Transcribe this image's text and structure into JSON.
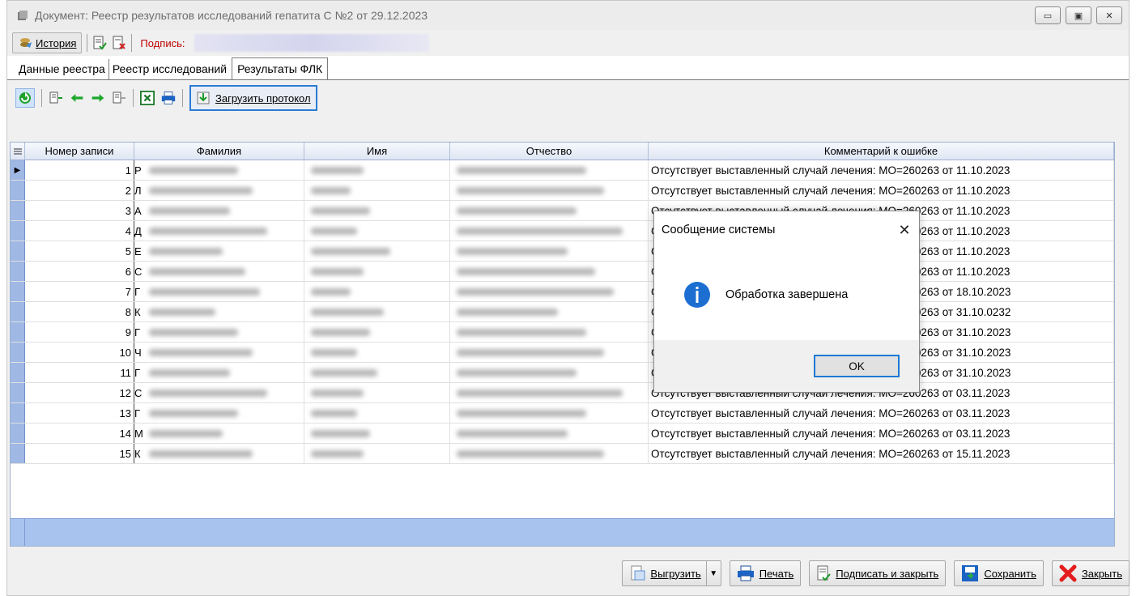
{
  "window": {
    "title": "Документ: Реестр результатов исследований гепатита С №2 от 29.12.2023",
    "btn_min": "▭",
    "btn_max": "▣",
    "btn_close": "✕"
  },
  "toolbar1": {
    "history_label": "История",
    "sign_label": "Подпись:"
  },
  "tabs": [
    {
      "label": "Данные реестра"
    },
    {
      "label": "Реестр исследований"
    },
    {
      "label": "Результаты ФЛК"
    }
  ],
  "toolbar2": {
    "load_protocol_label": "Загрузить протокол"
  },
  "grid": {
    "columns": [
      "Номер записи",
      "Фамилия",
      "Имя",
      "Отчество",
      "Комментарий к ошибке"
    ],
    "rows": [
      {
        "num": "1",
        "initial": "Р",
        "comment": "Отсутствует выставленный случай лечения: МО=260263 от 11.10.2023"
      },
      {
        "num": "2",
        "initial": "Л",
        "comment": "Отсутствует выставленный случай лечения: МО=260263 от 11.10.2023"
      },
      {
        "num": "3",
        "initial": "А",
        "comment": "Отсутствует выставленный случай лечения: МО=260263 от 11.10.2023"
      },
      {
        "num": "4",
        "initial": "Д",
        "comment": "Отсутствует выставленный случай лечения: МО=260263 от 11.10.2023"
      },
      {
        "num": "5",
        "initial": "Е",
        "comment": "Отсутствует выставленный случай лечения: МО=260263 от 11.10.2023"
      },
      {
        "num": "6",
        "initial": "С",
        "comment": "Отсутствует выставленный случай лечения: МО=260263 от 11.10.2023"
      },
      {
        "num": "7",
        "initial": "Г",
        "comment": "Отсутствует выставленный случай лечения: МО=260263 от 18.10.2023"
      },
      {
        "num": "8",
        "initial": "К",
        "comment": "Отсутствует выставленный случай лечения: МО=260263 от 31.10.0232"
      },
      {
        "num": "9",
        "initial": "Г",
        "comment": "Отсутствует выставленный случай лечения: МО=260263 от 31.10.2023"
      },
      {
        "num": "10",
        "initial": "Ч",
        "comment": "Отсутствует выставленный случай лечения: МО=260263 от 31.10.2023"
      },
      {
        "num": "11",
        "initial": "Г",
        "comment": "Отсутствует выставленный случай лечения: МО=260263 от 31.10.2023"
      },
      {
        "num": "12",
        "initial": "С",
        "comment": "Отсутствует выставленный случай лечения: МО=260263 от 03.11.2023"
      },
      {
        "num": "13",
        "initial": "Г",
        "comment": "Отсутствует выставленный случай лечения: МО=260263 от 03.11.2023"
      },
      {
        "num": "14",
        "initial": "М",
        "comment": "Отсутствует выставленный случай лечения: МО=260263 от 03.11.2023"
      },
      {
        "num": "15",
        "initial": "К",
        "comment": "Отсутствует выставленный случай лечения: МО=260263 от 15.11.2023"
      }
    ]
  },
  "bottom": {
    "export_label": "Выгрузить",
    "print_label": "Печать",
    "sign_close_label": "Подписать и закрыть",
    "save_label": "Сохранить",
    "close_label": "Закрыть"
  },
  "dialog": {
    "title": "Сообщение системы",
    "message": "Обработка завершена",
    "ok_label": "OK",
    "close_glyph": "✕"
  },
  "colors": {
    "accent_blue": "#2a7bd4",
    "grid_selection": "#a9c3ef",
    "sign_label": "#c00000"
  }
}
